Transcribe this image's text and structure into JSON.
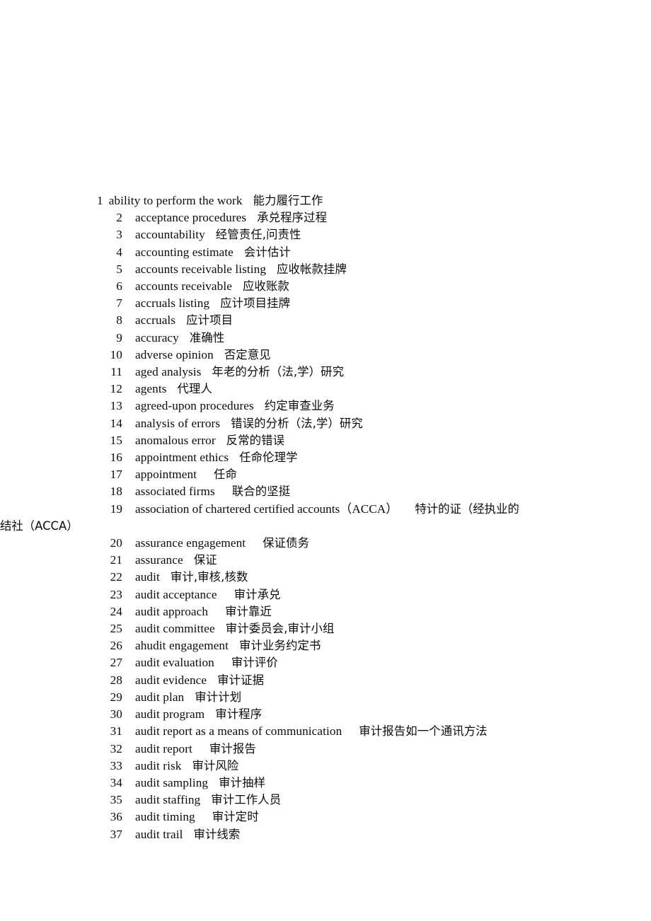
{
  "document": {
    "title": "Audit Terminology Glossary (English-Chinese)",
    "page_background": "#ffffff",
    "text_color": "#000000",
    "entries": [
      {
        "num": "1",
        "term": "ability to perform the work",
        "gloss": "能力履行工作",
        "gap": "m"
      },
      {
        "num": "2",
        "term": "acceptance procedures",
        "gloss": "承兑程序过程",
        "gap": "m"
      },
      {
        "num": "3",
        "term": "accountability",
        "gloss": "经管责任,问责性",
        "gap": "m"
      },
      {
        "num": "4",
        "term": "accounting estimate",
        "gloss": "会计估计",
        "gap": "m"
      },
      {
        "num": "5",
        "term": "accounts receivable listing",
        "gloss": "应收帐款挂牌",
        "gap": "m"
      },
      {
        "num": "6",
        "term": "accounts receivable",
        "gloss": "应收账款",
        "gap": "m"
      },
      {
        "num": "7",
        "term": "accruals listing",
        "gloss": "应计项目挂牌",
        "gap": "m"
      },
      {
        "num": "8",
        "term": "accruals",
        "gloss": "应计项目",
        "gap": "m"
      },
      {
        "num": "9",
        "term": "accuracy",
        "gloss": "准确性",
        "gap": "m"
      },
      {
        "num": "10",
        "term": "adverse opinion",
        "gloss": "否定意见",
        "gap": "m"
      },
      {
        "num": "11",
        "term": "aged analysis",
        "gloss": "年老的分析（法,学）研究",
        "gap": "m"
      },
      {
        "num": "12",
        "term": "agents",
        "gloss": "代理人",
        "gap": "m"
      },
      {
        "num": "13",
        "term": "agreed-upon procedures",
        "gloss": "约定审查业务",
        "gap": "m"
      },
      {
        "num": "14",
        "term": "analysis of errors",
        "gloss": "错误的分析（法,学）研究",
        "gap": "m"
      },
      {
        "num": "15",
        "term": "anomalous error",
        "gloss": "反常的错误",
        "gap": "m"
      },
      {
        "num": "16",
        "term": "appointment ethics",
        "gloss": "任命伦理学",
        "gap": "m"
      },
      {
        "num": "17",
        "term": "appointment",
        "gloss": "任命",
        "gap": "l"
      },
      {
        "num": "18",
        "term": "associated firms",
        "gloss": "联合的坚挺",
        "gap": "l"
      },
      {
        "num": "20",
        "term": "assurance engagement",
        "gloss": "保证债务",
        "gap": "l"
      },
      {
        "num": "21",
        "term": "assurance",
        "gloss": "保证",
        "gap": "m"
      },
      {
        "num": "22",
        "term": "audit",
        "gloss": "审计,审核,核数",
        "gap": "m"
      },
      {
        "num": "23",
        "term": "audit acceptance",
        "gloss": "审计承兑",
        "gap": "l"
      },
      {
        "num": "24",
        "term": "audit approach",
        "gloss": "审计靠近",
        "gap": "l"
      },
      {
        "num": "25",
        "term": "audit committee",
        "gloss": "审计委员会,审计小组",
        "gap": "m"
      },
      {
        "num": "26",
        "term": "ahudit engagement",
        "gloss": "审计业务约定书",
        "gap": "m"
      },
      {
        "num": "27",
        "term": "audit evaluation",
        "gloss": "审计评价",
        "gap": "l"
      },
      {
        "num": "28",
        "term": "audit evidence",
        "gloss": "审计证据",
        "gap": "m"
      },
      {
        "num": "29",
        "term": "audit plan",
        "gloss": "审计计划",
        "gap": "m"
      },
      {
        "num": "30",
        "term": "audit program",
        "gloss": "审计程序",
        "gap": "m"
      },
      {
        "num": "31",
        "term": "audit report as a means of communication",
        "gloss": "审计报告如一个通讯方法",
        "gap": "l"
      },
      {
        "num": "32",
        "term": "audit report",
        "gloss": "审计报告",
        "gap": "l"
      },
      {
        "num": "33",
        "term": "audit risk",
        "gloss": "审计风险",
        "gap": "m"
      },
      {
        "num": "34",
        "term": "audit sampling",
        "gloss": "审计抽样",
        "gap": "m"
      },
      {
        "num": "35",
        "term": "audit staffing",
        "gloss": "审计工作人员",
        "gap": "m"
      },
      {
        "num": "36",
        "term": "audit timing",
        "gloss": "审计定时",
        "gap": "l"
      },
      {
        "num": "37",
        "term": "audit trail",
        "gloss": "审计线索",
        "gap": "m"
      }
    ],
    "wrapped_entry": {
      "num": "19",
      "term": "association of chartered certified accounts（ACCA）",
      "gloss_line1": "特计的证（经执业的",
      "gloss_line2": "结社（ACCA）"
    }
  }
}
